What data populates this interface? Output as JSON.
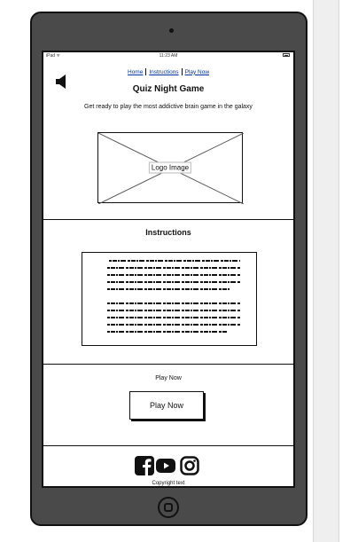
{
  "status_bar": {
    "carrier": "iPad ᯤ",
    "time": "11:23 AM"
  },
  "nav": {
    "items": [
      {
        "label": "Home"
      },
      {
        "label": "Instructions"
      },
      {
        "label": "Play Now"
      }
    ]
  },
  "header": {
    "title": "Quiz Night Game",
    "tagline": "Get ready to play the most addictive brain game in the galaxy"
  },
  "logo": {
    "label": "Logo Image"
  },
  "instructions": {
    "heading": "Instructions"
  },
  "play": {
    "label": "Play Now",
    "button_label": "Play Now"
  },
  "social": {
    "icons": [
      "facebook-icon",
      "youtube-icon",
      "instagram-icon"
    ]
  },
  "footer": {
    "copyright": "Copyright text"
  },
  "colors": {
    "link": "#0033aa",
    "device": "#4a4a4a"
  }
}
